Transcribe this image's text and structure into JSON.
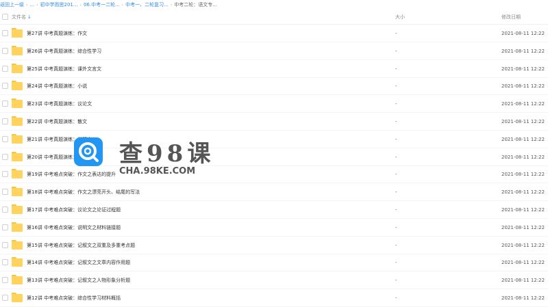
{
  "breadcrumb": [
    {
      "label": "返回上一级",
      "current": false
    },
    {
      "label": "...",
      "current": false
    },
    {
      "label": "初中学而思201...",
      "current": false
    },
    {
      "label": "06.中考一二轮...",
      "current": false
    },
    {
      "label": "中考一、二轮复习...",
      "current": false
    },
    {
      "label": "中考二轮：语文专...",
      "current": true
    }
  ],
  "table": {
    "headers": {
      "name": "文件名",
      "size": "大小",
      "date": "修改日期"
    },
    "rows": [
      {
        "name": "第27讲 中考真题演练：作文",
        "size": "-",
        "date": "2021-08-11 12:22"
      },
      {
        "name": "第26讲 中考真题演练：综合性学习",
        "size": "-",
        "date": "2021-08-11 12:22"
      },
      {
        "name": "第25讲 中考真题演练：课外文言文",
        "size": "-",
        "date": "2021-08-11 12:22"
      },
      {
        "name": "第24讲 中考真题演练：小说",
        "size": "-",
        "date": "2021-08-11 12:22"
      },
      {
        "name": "第23讲 中考真题演练：议论文",
        "size": "-",
        "date": "2021-08-11 12:22"
      },
      {
        "name": "第22讲 中考真题演练：散文",
        "size": "-",
        "date": "2021-08-11 12:22"
      },
      {
        "name": "第21讲 中考真题演练：说明文",
        "size": "-",
        "date": "2021-08-11 12:22"
      },
      {
        "name": "第20讲 中考真题演练：记叙文",
        "size": "-",
        "date": "2021-08-11 12:22"
      },
      {
        "name": "第19讲 中考难点突破：作文之表达的提升",
        "size": "-",
        "date": "2021-08-11 12:22"
      },
      {
        "name": "第18讲 中考难点突破：作文之漂亮开头、结尾的写法",
        "size": "-",
        "date": "2021-08-11 12:22"
      },
      {
        "name": "第17讲 中考难点突破：议论文之论证过程题",
        "size": "-",
        "date": "2021-08-11 12:22"
      },
      {
        "name": "第16讲 中考难点突破：说明文之材料链接题",
        "size": "-",
        "date": "2021-08-11 12:22"
      },
      {
        "name": "第15讲 中考难点突破：记叙文之双重及多重考点题",
        "size": "-",
        "date": "2021-08-11 12:22"
      },
      {
        "name": "第14讲 中考难点突破：记叙文之文章内容作用题",
        "size": "-",
        "date": "2021-08-11 12:22"
      },
      {
        "name": "第13讲 中考难点突破：记叙文之人物形象分析题",
        "size": "-",
        "date": "2021-08-11 12:22"
      },
      {
        "name": "第12讲 中考难点突破：综合性学习材料概括",
        "size": "-",
        "date": "2021-08-11 12:22"
      }
    ]
  },
  "watermark": {
    "title": "查98课",
    "url": "CHA.98KE.COM",
    "logo_color": "#2196f3"
  },
  "colors": {
    "link": "#2e8be6",
    "folder": "#ffd35c"
  }
}
